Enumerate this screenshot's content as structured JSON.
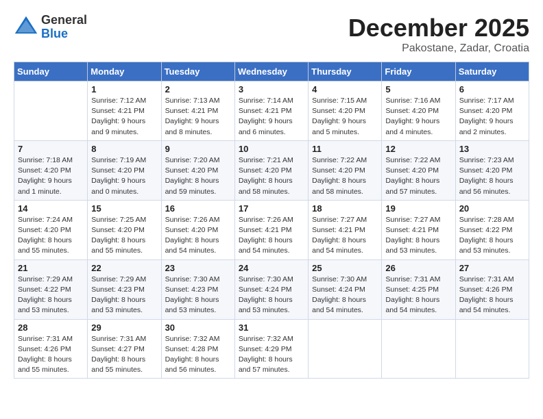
{
  "header": {
    "logo_general": "General",
    "logo_blue": "Blue",
    "month_year": "December 2025",
    "location": "Pakostane, Zadar, Croatia"
  },
  "calendar": {
    "days_of_week": [
      "Sunday",
      "Monday",
      "Tuesday",
      "Wednesday",
      "Thursday",
      "Friday",
      "Saturday"
    ],
    "weeks": [
      [
        {
          "day": "",
          "info": ""
        },
        {
          "day": "1",
          "info": "Sunrise: 7:12 AM\nSunset: 4:21 PM\nDaylight: 9 hours\nand 9 minutes."
        },
        {
          "day": "2",
          "info": "Sunrise: 7:13 AM\nSunset: 4:21 PM\nDaylight: 9 hours\nand 8 minutes."
        },
        {
          "day": "3",
          "info": "Sunrise: 7:14 AM\nSunset: 4:21 PM\nDaylight: 9 hours\nand 6 minutes."
        },
        {
          "day": "4",
          "info": "Sunrise: 7:15 AM\nSunset: 4:20 PM\nDaylight: 9 hours\nand 5 minutes."
        },
        {
          "day": "5",
          "info": "Sunrise: 7:16 AM\nSunset: 4:20 PM\nDaylight: 9 hours\nand 4 minutes."
        },
        {
          "day": "6",
          "info": "Sunrise: 7:17 AM\nSunset: 4:20 PM\nDaylight: 9 hours\nand 2 minutes."
        }
      ],
      [
        {
          "day": "7",
          "info": "Sunrise: 7:18 AM\nSunset: 4:20 PM\nDaylight: 9 hours\nand 1 minute."
        },
        {
          "day": "8",
          "info": "Sunrise: 7:19 AM\nSunset: 4:20 PM\nDaylight: 9 hours\nand 0 minutes."
        },
        {
          "day": "9",
          "info": "Sunrise: 7:20 AM\nSunset: 4:20 PM\nDaylight: 8 hours\nand 59 minutes."
        },
        {
          "day": "10",
          "info": "Sunrise: 7:21 AM\nSunset: 4:20 PM\nDaylight: 8 hours\nand 58 minutes."
        },
        {
          "day": "11",
          "info": "Sunrise: 7:22 AM\nSunset: 4:20 PM\nDaylight: 8 hours\nand 58 minutes."
        },
        {
          "day": "12",
          "info": "Sunrise: 7:22 AM\nSunset: 4:20 PM\nDaylight: 8 hours\nand 57 minutes."
        },
        {
          "day": "13",
          "info": "Sunrise: 7:23 AM\nSunset: 4:20 PM\nDaylight: 8 hours\nand 56 minutes."
        }
      ],
      [
        {
          "day": "14",
          "info": "Sunrise: 7:24 AM\nSunset: 4:20 PM\nDaylight: 8 hours\nand 55 minutes."
        },
        {
          "day": "15",
          "info": "Sunrise: 7:25 AM\nSunset: 4:20 PM\nDaylight: 8 hours\nand 55 minutes."
        },
        {
          "day": "16",
          "info": "Sunrise: 7:26 AM\nSunset: 4:20 PM\nDaylight: 8 hours\nand 54 minutes."
        },
        {
          "day": "17",
          "info": "Sunrise: 7:26 AM\nSunset: 4:21 PM\nDaylight: 8 hours\nand 54 minutes."
        },
        {
          "day": "18",
          "info": "Sunrise: 7:27 AM\nSunset: 4:21 PM\nDaylight: 8 hours\nand 54 minutes."
        },
        {
          "day": "19",
          "info": "Sunrise: 7:27 AM\nSunset: 4:21 PM\nDaylight: 8 hours\nand 53 minutes."
        },
        {
          "day": "20",
          "info": "Sunrise: 7:28 AM\nSunset: 4:22 PM\nDaylight: 8 hours\nand 53 minutes."
        }
      ],
      [
        {
          "day": "21",
          "info": "Sunrise: 7:29 AM\nSunset: 4:22 PM\nDaylight: 8 hours\nand 53 minutes."
        },
        {
          "day": "22",
          "info": "Sunrise: 7:29 AM\nSunset: 4:23 PM\nDaylight: 8 hours\nand 53 minutes."
        },
        {
          "day": "23",
          "info": "Sunrise: 7:30 AM\nSunset: 4:23 PM\nDaylight: 8 hours\nand 53 minutes."
        },
        {
          "day": "24",
          "info": "Sunrise: 7:30 AM\nSunset: 4:24 PM\nDaylight: 8 hours\nand 53 minutes."
        },
        {
          "day": "25",
          "info": "Sunrise: 7:30 AM\nSunset: 4:24 PM\nDaylight: 8 hours\nand 54 minutes."
        },
        {
          "day": "26",
          "info": "Sunrise: 7:31 AM\nSunset: 4:25 PM\nDaylight: 8 hours\nand 54 minutes."
        },
        {
          "day": "27",
          "info": "Sunrise: 7:31 AM\nSunset: 4:26 PM\nDaylight: 8 hours\nand 54 minutes."
        }
      ],
      [
        {
          "day": "28",
          "info": "Sunrise: 7:31 AM\nSunset: 4:26 PM\nDaylight: 8 hours\nand 55 minutes."
        },
        {
          "day": "29",
          "info": "Sunrise: 7:31 AM\nSunset: 4:27 PM\nDaylight: 8 hours\nand 55 minutes."
        },
        {
          "day": "30",
          "info": "Sunrise: 7:32 AM\nSunset: 4:28 PM\nDaylight: 8 hours\nand 56 minutes."
        },
        {
          "day": "31",
          "info": "Sunrise: 7:32 AM\nSunset: 4:29 PM\nDaylight: 8 hours\nand 57 minutes."
        },
        {
          "day": "",
          "info": ""
        },
        {
          "day": "",
          "info": ""
        },
        {
          "day": "",
          "info": ""
        }
      ]
    ]
  }
}
